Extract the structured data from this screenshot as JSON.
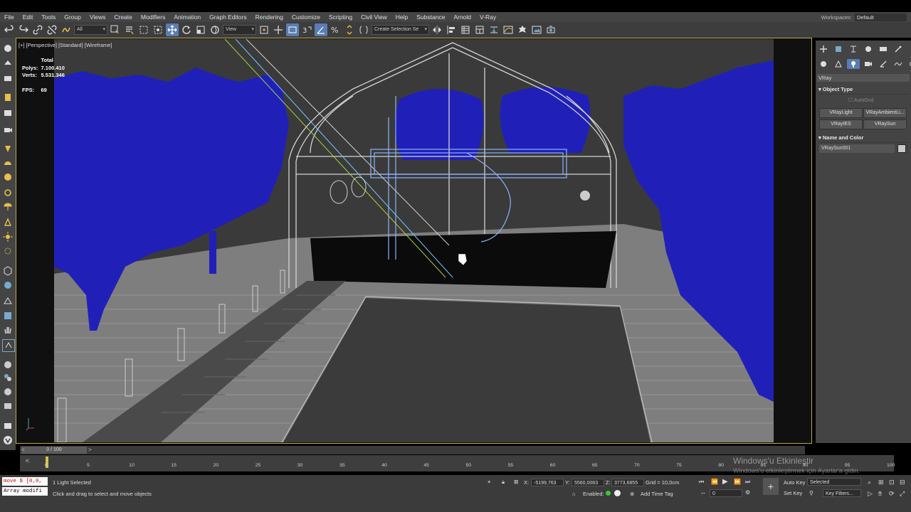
{
  "menu": {
    "items": [
      "File",
      "Edit",
      "Tools",
      "Group",
      "Views",
      "Create",
      "Modifiers",
      "Animation",
      "Graph Editors",
      "Rendering",
      "Customize",
      "Scripting",
      "Civil View",
      "Help",
      "Substance",
      "Arnold",
      "V-Ray"
    ],
    "workspaces_label": "Workspaces:",
    "workspace_value": "Default"
  },
  "toolbar": {
    "filter_value": "All",
    "refcoord_value": "View",
    "selection_set_placeholder": "Create Selection Se"
  },
  "viewport": {
    "label": "[+] [Perspective] [Standard] [Wireframe]",
    "stats": {
      "header": "Total",
      "polys_label": "Polys:",
      "polys_value": "7.100.410",
      "verts_label": "Verts:",
      "verts_value": "5.531.346",
      "fps_label": "FPS:",
      "fps_value": "69"
    },
    "colors": {
      "background": "#3a3a3a",
      "trees": "#2020b8",
      "ground": "#8a8a8a",
      "wire": "#d0d0d0",
      "selected": "#8ab4ff"
    }
  },
  "command_panel": {
    "category_value": "VRay",
    "object_type_title": "Object Type",
    "autogrid_label": "AutoGrid",
    "buttons": [
      "VRayLight",
      "VRayAmbientLi...",
      "VRayIES",
      "VRaySun"
    ],
    "name_color_title": "Name and Color",
    "object_name": "VRaySun001",
    "object_color": "#c8c8c8"
  },
  "timeline": {
    "slider_text": "0 / 100",
    "ticks": [
      "0",
      "5",
      "10",
      "15",
      "20",
      "25",
      "30",
      "35",
      "40",
      "45",
      "50",
      "55",
      "60",
      "65",
      "70",
      "75",
      "80",
      "85",
      "90",
      "95",
      "100"
    ]
  },
  "status": {
    "maxscript_line1": "move $ [0,0,",
    "maxscript_line2": "Array modifi",
    "selection_text": "1 Light Selected",
    "prompt_text": "Click and drag to select and move objects",
    "x_label": "X:",
    "x_value": "-5199,763",
    "y_label": "Y:",
    "y_value": "5560,0083",
    "z_label": "Z:",
    "z_value": "3773,6855",
    "grid_text": "Grid = 10,0cm",
    "enabled_label": "Enabled:",
    "add_time_tag": "Add Time Tag",
    "frame_value": "0",
    "auto_key": "Auto Key",
    "set_key": "Set Key",
    "key_mode_value": "Selected",
    "key_filters": "Key Filters..."
  },
  "watermark": {
    "line1": "Windows'u Etkinleştir",
    "line2": "Windows'u etkinleştirmek için Ayarlar'a gidin."
  }
}
